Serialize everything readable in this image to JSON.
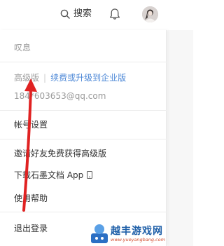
{
  "header": {
    "search_label": "搜索",
    "icons": [
      "search-icon",
      "bell-icon",
      "avatar"
    ]
  },
  "menu": {
    "username": "叹息",
    "plan_level": "高级版",
    "plan_separator": "|",
    "upgrade_link": "续费或升级到企业版",
    "email": "184*603653@qq.com",
    "account_settings": "帐号设置",
    "invite_friends": "邀请好友免费获得高级版",
    "download_app": "下载石墨文档 App",
    "help": "使用帮助",
    "logout": "退出登录"
  },
  "annotation": {
    "arrow_color": "#e02222"
  },
  "watermark": {
    "title": "越丰游戏网",
    "url": "www.yueyangbang.com"
  }
}
